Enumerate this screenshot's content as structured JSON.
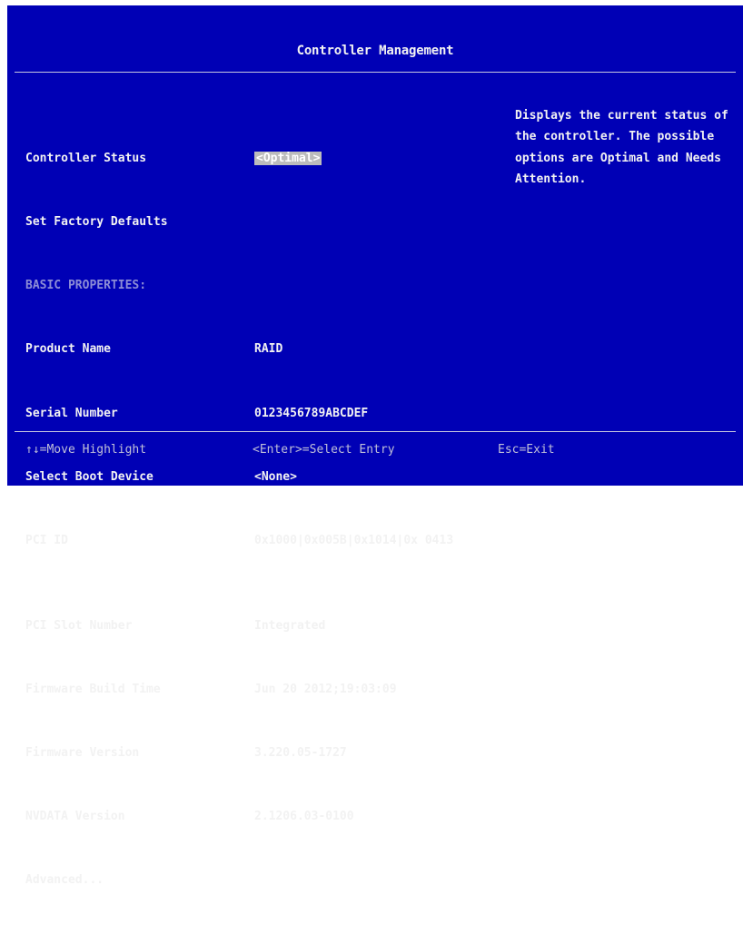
{
  "title": "Controller Management",
  "labels": {
    "controller_status": "Controller Status",
    "set_factory_defaults": "Set Factory Defaults",
    "basic_properties": "BASIC PROPERTIES:",
    "product_name": "Product Name",
    "serial_number": "Serial Number",
    "select_boot_device": "Select Boot Device",
    "pci_id": "PCI ID",
    "pci_slot_number": "PCI Slot Number",
    "firmware_build_time": "Firmware Build Time",
    "firmware_version": "Firmware Version",
    "nvdata_version": "NVDATA Version",
    "advanced": "Advanced..."
  },
  "values": {
    "controller_status": "<Optimal>",
    "product_name": "RAID",
    "serial_number": "0123456789ABCDEF",
    "select_boot_device": "<None>",
    "pci_id": "0x1000|0x005B|0x1014|0x 0413",
    "pci_slot_number": "Integrated",
    "firmware_build_time": "Jun 20 2012;19:03:09",
    "firmware_version": "3.220.05-1727",
    "nvdata_version": "2.1206.03-0100"
  },
  "help_text": "Displays the current status of the controller. The possible options are Optimal and Needs Attention.",
  "footer": {
    "move": "↑↓=Move Highlight",
    "select": "<Enter>=Select Entry",
    "exit": "Esc=Exit"
  },
  "colors": {
    "background": "#0000b5",
    "text": "#f2f2f2",
    "section_header": "#8d8dd6",
    "highlight": "#bcbcbc"
  }
}
